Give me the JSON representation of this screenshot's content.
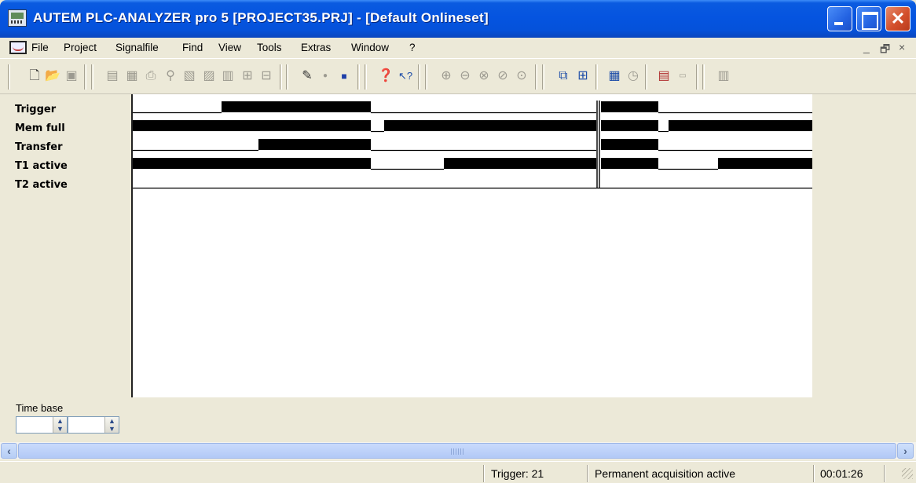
{
  "window": {
    "title": "AUTEM PLC-ANALYZER pro 5 [PROJECT35.PRJ] - [Default Onlineset]",
    "close_label": "✕"
  },
  "menu": {
    "items": [
      "File",
      "Project",
      "Signalfile",
      "Find",
      "View",
      "Tools",
      "Extras",
      "Window",
      "?"
    ],
    "mdi_minimize": "_",
    "mdi_restore": "🗗",
    "mdi_close": "×"
  },
  "toolbar": {
    "icons": [
      "new-icon",
      "open-icon",
      "save-icon",
      "open-signal-icon",
      "save-signal-icon",
      "print-icon",
      "find-icon",
      "text-export-icon",
      "exp-icon",
      "import-icon",
      "compare-icon",
      "merge-icon",
      "edit-icon",
      "record-icon",
      "stop-icon",
      "help-icon",
      "context-help-icon",
      "zoom-in-icon",
      "zoom-out-icon",
      "zoom-range-icon",
      "zoom-all-icon",
      "zoom-marker-icon",
      "cascade-icon",
      "tile-icon",
      "grid-icon",
      "clock-icon",
      "signal-list-icon",
      "numeric-icon",
      "panel-icon"
    ]
  },
  "signals": {
    "labels": [
      "Trigger",
      "Mem full",
      "Transfer",
      "T1 active",
      "T2 active"
    ],
    "states": [
      [
        [
          0,
          113,
          0
        ],
        [
          113,
          303,
          1
        ],
        [
          303,
          590,
          0
        ],
        [
          596,
          669,
          1
        ],
        [
          669,
          865,
          0
        ]
      ],
      [
        [
          0,
          303,
          1
        ],
        [
          303,
          320,
          0
        ],
        [
          320,
          590,
          1
        ],
        [
          596,
          669,
          1
        ],
        [
          669,
          682,
          0
        ],
        [
          682,
          865,
          1
        ]
      ],
      [
        [
          0,
          160,
          0
        ],
        [
          160,
          303,
          1
        ],
        [
          303,
          590,
          0
        ],
        [
          596,
          669,
          1
        ],
        [
          669,
          865,
          0
        ]
      ],
      [
        [
          0,
          303,
          1
        ],
        [
          303,
          396,
          0
        ],
        [
          396,
          590,
          1
        ],
        [
          596,
          669,
          1
        ],
        [
          669,
          745,
          0
        ],
        [
          745,
          865,
          1
        ]
      ],
      [
        [
          0,
          865,
          0
        ]
      ]
    ],
    "colors": {
      "high": "#000000",
      "low": "#000000",
      "background": "#ffffff"
    }
  },
  "timebase": {
    "label": "Time base",
    "value1": "",
    "value2": ""
  },
  "status": {
    "trigger": "Trigger: 21",
    "acquisition": "Permanent acquisition active",
    "time": "00:01:26"
  }
}
